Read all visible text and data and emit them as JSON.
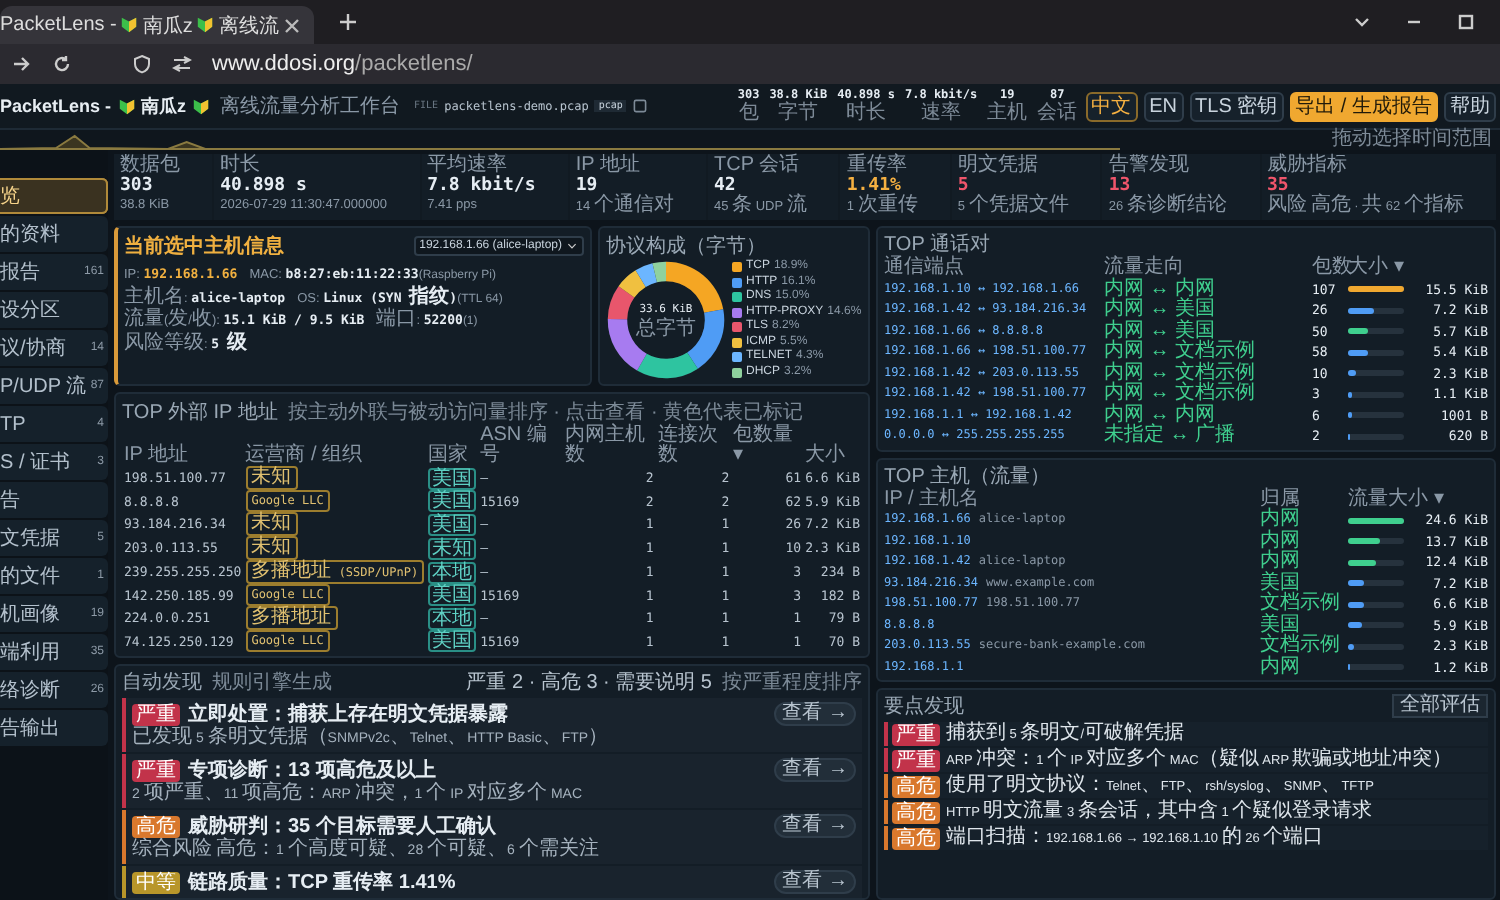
{
  "browser": {
    "tab_title": "PacketLens - ",
    "tab_title_mid": "南瓜z",
    "tab_title_end": "离线流",
    "url_host": "www.ddosi.org",
    "url_path": "/packetlens/"
  },
  "header": {
    "brand": "PacketLens -",
    "brand_mid": "南瓜z",
    "subtitle": "离线流量分析工作台",
    "file_label": "FILE",
    "file_name": "packetlens-demo.pcap",
    "file_type": "pcap",
    "stats": [
      {
        "value": "303",
        "label": "包"
      },
      {
        "value": "38.8 KiB",
        "label": "字节"
      },
      {
        "value": "40.898 s",
        "label": "时长"
      },
      {
        "value": "7.8 kbit/s",
        "label": "速率"
      },
      {
        "value": "19",
        "label": "主机"
      },
      {
        "value": "87",
        "label": "会话"
      }
    ],
    "buttons": [
      {
        "label": "中文",
        "kind": "lang",
        "selected": true
      },
      {
        "label": "EN",
        "kind": "lang",
        "selected": false
      },
      {
        "label": "TLS 密钥",
        "kind": "plain"
      },
      {
        "label": "导出 / 生成报告",
        "kind": "primary"
      },
      {
        "label": "帮助",
        "kind": "plain"
      }
    ],
    "timeline_hint": "拖动选择时间范围"
  },
  "kpis": [
    {
      "label": "数据包",
      "value": "303",
      "sub": "38.8 KiB",
      "color": "#e6edf3"
    },
    {
      "label": "时长",
      "value": "40.898 s",
      "sub": "2026-07-29 11:30:47.000000",
      "color": "#e6edf3"
    },
    {
      "label": "平均速率",
      "value": "7.8 kbit/s",
      "sub": "7.41 pps",
      "color": "#e6edf3"
    },
    {
      "label": "IP 地址",
      "value": "19",
      "sub": "14 个通信对",
      "color": "#e6edf3"
    },
    {
      "label": "TCP 会话",
      "value": "42",
      "sub": "45 条 UDP 流",
      "color": "#e6edf3"
    },
    {
      "label": "重传率",
      "value": "1.41%",
      "sub": "1 次重传",
      "color": "#f5b041"
    },
    {
      "label": "明文凭据",
      "value": "5",
      "sub": "5 个凭据文件",
      "color": "#f0556b"
    },
    {
      "label": "告警发现",
      "value": "13",
      "sub": "26 条诊断结论",
      "color": "#f0556b"
    },
    {
      "label": "威胁指标",
      "value": "35",
      "sub": "风险 高危 · 共 62 个指标",
      "color": "#f0556b"
    }
  ],
  "sidebar": {
    "items": [
      {
        "label": "览",
        "selected": true
      },
      {
        "label": "的资料",
        "selected": false
      },
      {
        "label": "报告",
        "count": "161",
        "selected": false
      },
      {
        "label": "设分区",
        "selected": false
      },
      {
        "label": "议/协商",
        "count": "14",
        "selected": false
      },
      {
        "label": "P/UDP 流",
        "count": "87",
        "selected": false
      },
      {
        "label": "TP",
        "count": "4",
        "selected": false
      },
      {
        "label": "S / 证书",
        "count": "3",
        "selected": false
      },
      {
        "label": "告",
        "selected": false
      },
      {
        "label": "文凭据",
        "count": "5",
        "selected": false
      },
      {
        "label": "的文件",
        "count": "1",
        "selected": false
      },
      {
        "label": "机画像",
        "count": "19",
        "selected": false
      },
      {
        "label": "端利用",
        "count": "35",
        "selected": false
      },
      {
        "label": "络诊断",
        "count": "26",
        "selected": false
      },
      {
        "label": "告输出",
        "selected": false
      }
    ]
  },
  "host_card": {
    "title": "当前选中主机信息",
    "selected_host": "192.168.1.66 (alice-laptop)",
    "fields": [
      {
        "label": "IP:",
        "value": "192.168.1.66"
      },
      {
        "label": "MAC:",
        "value": "b8:27:eb:11:22:33",
        "note": "(Raspberry Pi)"
      },
      {
        "label": "主机名:",
        "value": "alice-laptop"
      },
      {
        "label": "OS:",
        "value": "Linux (SYN 指纹)",
        "note": "(TTL 64)"
      },
      {
        "label": "流量(发/收):",
        "value": "15.1 KiB / 9.5 KiB"
      },
      {
        "label": "端口:",
        "value": "52200",
        "note": "(1)"
      },
      {
        "label": "风险等级:",
        "value": "5 级"
      }
    ]
  },
  "protocols": {
    "total": "33.6 KiB",
    "total_label": "总字节",
    "legend": [
      {
        "share": "18.9%",
        "color": "#f5a623"
      },
      {
        "share": "16.1%",
        "color": "#4f9cf5"
      },
      {
        "share": "15.0%",
        "color": "#2ec4a0"
      },
      {
        "share": "14.6%",
        "color": "#a77bf0"
      },
      {
        "share": "8.2%",
        "color": "#e8566c"
      },
      {
        "share": "5.5%",
        "color": "#f0c040"
      },
      {
        "share": "4.3%",
        "color": "#6cb6ff"
      },
      {
        "share": "3.2%",
        "color": "#8fd19e"
      }
    ],
    "chart_data": {
      "type": "donut",
      "title": "协议构成（字节）",
      "categories": [
        "TCP",
        "HTTP",
        "DNS",
        "HTTP-PROXY",
        "TLS",
        "ICMP",
        "TELNET",
        "DHCP"
      ],
      "values": [
        22.03,
        18.76,
        17.48,
        17.02,
        9.56,
        6.41,
        5.01,
        3.73
      ]
    }
  },
  "external_ips": {
    "title": "TOP 外部 IP 地址",
    "note": "按主动外联与被动访问量排序 · 点击查看 · 黄色代表已标记",
    "columns": [
      "IP 地址",
      "运营商 / 组织",
      "国家",
      "ASN 编号",
      "内网主机数",
      "连接次数",
      "包数量 ▾",
      "大小"
    ],
    "rows": [
      [
        "198.51.100.77",
        "未知",
        "美国",
        "—",
        "2",
        "2",
        "61",
        "6.6 KiB"
      ],
      [
        "8.8.8.8",
        "Google LLC",
        "美国",
        "15169",
        "2",
        "2",
        "62",
        "5.9 KiB"
      ],
      [
        "93.184.216.34",
        "未知",
        "美国",
        "—",
        "1",
        "1",
        "26",
        "7.2 KiB"
      ],
      [
        "203.0.113.55",
        "未知",
        "未知",
        "—",
        "1",
        "1",
        "10",
        "2.3 KiB"
      ],
      [
        "239.255.255.250",
        "多播地址 (SSDP/UPnP)",
        "本地",
        "—",
        "1",
        "1",
        "3",
        "234 B"
      ],
      [
        "142.250.185.99",
        "Google LLC",
        "美国",
        "15169",
        "1",
        "1",
        "3",
        "182 B"
      ],
      [
        "224.0.0.251",
        "多播地址",
        "本地",
        "—",
        "1",
        "1",
        "1",
        "79 B"
      ],
      [
        "74.125.250.129",
        "Google LLC",
        "美国",
        "15169",
        "1",
        "1",
        "1",
        "70 B"
      ]
    ]
  },
  "findings": {
    "title": "自动发现",
    "subtitle": "规则引擎生成",
    "summary": "严重 2 · 高危 3 · 需要说明 5",
    "sort_hint": "按严重程度排序",
    "items": [
      {
        "kind": "critical",
        "tag": "严重",
        "title": "立即处置：捕获上存在明文凭据暴露",
        "body": "已发现 5 条明文凭据（SNMPv2c、Telnet、HTTP Basic、FTP）",
        "action": "查看 →"
      },
      {
        "kind": "critical",
        "tag": "严重",
        "title": "专项诊断：13 项高危及以上",
        "body": "2 项严重、11 项高危：ARP 冲突，1 个 IP 对应多个 MAC",
        "action": "查看 →"
      },
      {
        "kind": "high",
        "tag": "高危",
        "title": "威胁研判：35 个目标需要人工确认",
        "body": "综合风险 高危：1 个高度可疑、28 个可疑、6 个需关注",
        "action": "查看 →"
      },
      {
        "kind": "medium",
        "tag": "中等",
        "title": "链路质量：TCP 重传率 1.41%",
        "action": "查看 →"
      }
    ]
  },
  "sessions": {
    "title": "TOP 通话对",
    "columns": [
      "通信端点",
      "流量走向",
      "包数",
      "大小 ▾"
    ],
    "rows": [
      {
        "endpoints": "192.168.1.10 ↔ 192.168.1.66",
        "direction": "内网 ↔ 内网",
        "packets": "107",
        "size": "15.5 KiB",
        "level": 1.0
      },
      {
        "endpoints": "192.168.1.42 ↔ 93.184.216.34",
        "direction": "内网 ↔ 美国",
        "packets": "26",
        "size": "7.2 KiB",
        "level": 0.46
      },
      {
        "endpoints": "192.168.1.66 ↔ 8.8.8.8",
        "direction": "内网 ↔ 美国",
        "packets": "50",
        "size": "5.7 KiB",
        "level": 0.37
      },
      {
        "endpoints": "192.168.1.66 ↔ 198.51.100.77",
        "direction": "内网 ↔ 文档示例",
        "packets": "58",
        "size": "5.4 KiB",
        "level": 0.35
      },
      {
        "endpoints": "192.168.1.42 ↔ 203.0.113.55",
        "direction": "内网 ↔ 文档示例",
        "packets": "10",
        "size": "2.3 KiB",
        "level": 0.15
      },
      {
        "endpoints": "192.168.1.42 ↔ 198.51.100.77",
        "direction": "内网 ↔ 文档示例",
        "packets": "3",
        "size": "1.1 KiB",
        "level": 0.07
      },
      {
        "endpoints": "192.168.1.1 ↔ 192.168.1.42",
        "direction": "内网 ↔ 内网",
        "packets": "6",
        "size": "1001 B",
        "level": 0.06
      },
      {
        "endpoints": "0.0.0.0 ↔ 255.255.255.255",
        "direction": "未指定 ↔ 广播",
        "packets": "2",
        "size": "620 B",
        "level": 0.04
      }
    ]
  },
  "hosts": {
    "title": "TOP 主机（流量）",
    "columns": [
      "IP / 主机名",
      "归属",
      "流量大小 ▾"
    ],
    "rows": [
      {
        "ip": "192.168.1.66",
        "name": "alice-laptop",
        "zone": "内网",
        "size": "24.6 KiB",
        "level": 1.0
      },
      {
        "ip": "192.168.1.10",
        "zone": "内网",
        "size": "13.7 KiB",
        "level": 0.56
      },
      {
        "ip": "192.168.1.42",
        "name": "alice-laptop",
        "zone": "内网",
        "size": "12.4 KiB",
        "level": 0.5
      },
      {
        "ip": "93.184.216.34",
        "name": "www.example.com",
        "zone": "美国",
        "size": "7.2 KiB",
        "level": 0.29
      },
      {
        "ip": "198.51.100.77",
        "name": "198.51.100.77",
        "zone": "文档示例",
        "size": "6.6 KiB",
        "level": 0.27
      },
      {
        "ip": "8.8.8.8",
        "zone": "美国",
        "size": "5.9 KiB",
        "level": 0.24
      },
      {
        "ip": "203.0.113.55",
        "name": "secure-bank-example.com",
        "zone": "文档示例",
        "size": "2.3 KiB",
        "level": 0.09
      },
      {
        "ip": "192.168.1.1",
        "zone": "内网",
        "size": "1.2 KiB",
        "level": 0.05
      }
    ]
  },
  "key_findings": {
    "title": "要点发现",
    "button": "全部评估",
    "items": [
      {
        "kind": "critical",
        "tag": "严重",
        "text": "捕获到 5 条明文/可破解凭据"
      },
      {
        "kind": "critical",
        "tag": "严重",
        "text": "ARP 冲突：1 个 IP 对应多个 MAC（疑似 ARP 欺骗或地址冲突）"
      },
      {
        "kind": "high",
        "tag": "高危",
        "text": "使用了明文协议：Telnet、FTP、rsh/syslog、SNMP、TFTP"
      },
      {
        "kind": "high",
        "tag": "高危",
        "text": "HTTP 明文流量 3 条会话，其中含 1 个疑似登录请求"
      },
      {
        "kind": "high",
        "tag": "高危",
        "text": "端口扫描：192.168.1.66 → 192.168.1.10 的 26 个端口"
      }
    ]
  }
}
